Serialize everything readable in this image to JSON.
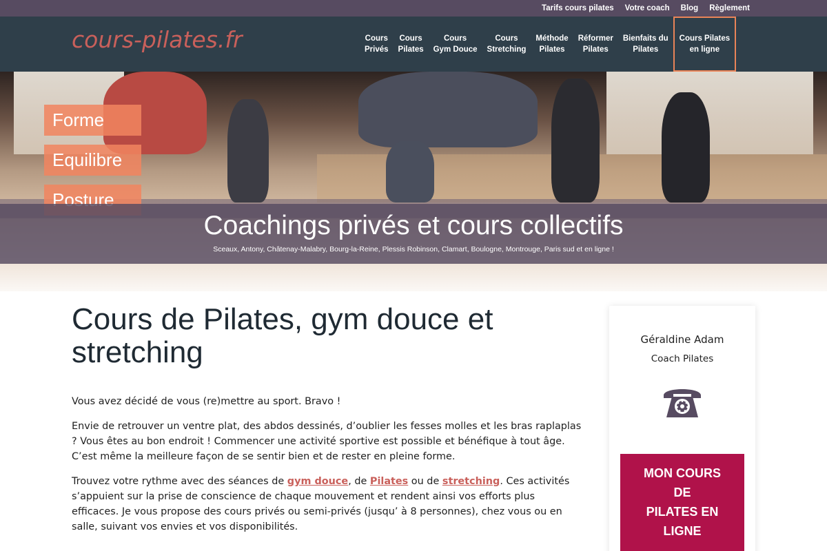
{
  "topbar": {
    "links": [
      "Tarifs cours pilates",
      "Votre coach",
      "Blog",
      "Règlement"
    ]
  },
  "header": {
    "logo": "cours-pilates.fr",
    "nav": [
      {
        "line1": "Cours",
        "line2": "Privés"
      },
      {
        "line1": "Cours",
        "line2": "Pilates"
      },
      {
        "line1": "Cours",
        "line2": "Gym Douce"
      },
      {
        "line1": "Cours",
        "line2": "Stretching"
      },
      {
        "line1": "Méthode",
        "line2": "Pilates"
      },
      {
        "line1": "Réformer",
        "line2": "Pilates"
      },
      {
        "line1": "Bienfaits du",
        "line2": "Pilates"
      },
      {
        "line1": "Cours Pilates",
        "line2": "en ligne"
      }
    ],
    "accent_color": "#ea8458"
  },
  "hero": {
    "pills": [
      "Forme",
      "Equilibre",
      "Posture"
    ],
    "title": "Coachings privés et cours collectifs",
    "subtitle": "Sceaux, Antony, Châtenay-Malabry, Bourg-la-Reine, Plessis Robinson, Clamart, Boulogne, Montrouge, Paris sud et en ligne !"
  },
  "main": {
    "title": "Cours de Pilates, gym douce et stretching",
    "p1": "Vous avez décidé de vous (re)mettre au sport. Bravo !",
    "p2": "Envie de retrouver un ventre plat, des abdos dessinés, d’oublier les fesses molles et les bras raplaplas ? Vous êtes au bon endroit ! Commencer une activité sportive est possible et bénéfique à tout âge. C’est même la meilleure façon de se sentir bien et de rester en pleine forme.",
    "p3": {
      "t1": "Trouvez votre rythme avec des séances de ",
      "link1": "gym douce",
      "t2": ", de ",
      "link2": "Pilates",
      "t3": " ou de ",
      "link3": "stretching",
      "t4": ". Ces activités s’appuient sur la prise de conscience de chaque mouvement et rendent ainsi vos efforts plus efficaces. Je vous propose des cours privés ou semi-privés (jusqu’ à 8 personnes), chez vous ou en salle, suivant vos envies et vos disponibilités."
    }
  },
  "sidebar": {
    "name": "Géraldine Adam",
    "role": "Coach Pilates",
    "phone_icon": "phone-icon",
    "cta": [
      "Mon cours",
      "de",
      "Pilates en",
      "ligne"
    ],
    "cta_color": "#b0124a"
  },
  "colors": {
    "topbar": "#574b61",
    "header": "#2f3f4a",
    "logo": "#c9605b",
    "pill": "#f1855f",
    "banner": "#584c62"
  }
}
